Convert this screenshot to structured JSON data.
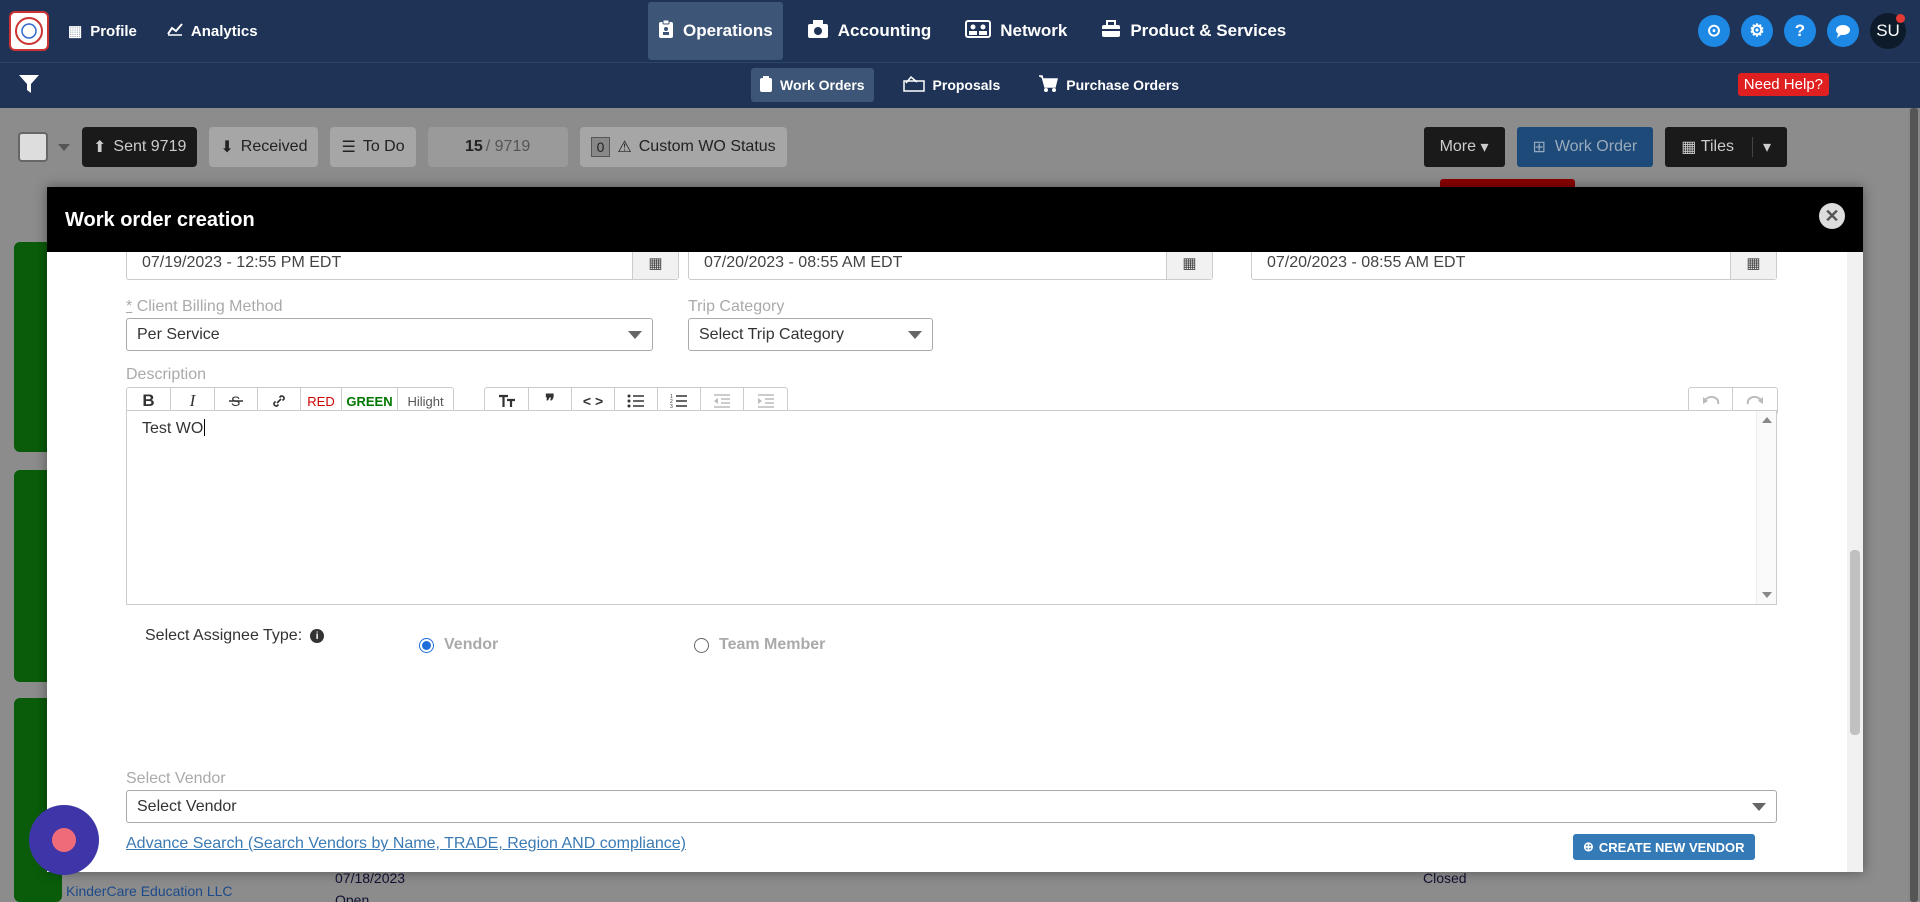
{
  "topnav": {
    "left": [
      {
        "label": "Profile",
        "icon": "building-icon"
      },
      {
        "label": "Analytics",
        "icon": "chart-line-icon"
      }
    ],
    "center": [
      {
        "label": "Operations",
        "icon": "clipboard-icon",
        "active": true
      },
      {
        "label": "Accounting",
        "icon": "money-icon"
      },
      {
        "label": "Network",
        "icon": "people-icon"
      },
      {
        "label": "Product & Services",
        "icon": "briefcase-icon"
      }
    ],
    "avatar": "SU"
  },
  "subnav": {
    "items": [
      {
        "label": "Work Orders",
        "icon": "clipboard-icon",
        "active": true
      },
      {
        "label": "Proposals",
        "icon": "proposal-icon"
      },
      {
        "label": "Purchase Orders",
        "icon": "cart-icon"
      }
    ],
    "need_help": "Need Help?"
  },
  "background_toolbar": {
    "sent": "Sent 9719",
    "received": "Received",
    "todo": "To Do",
    "count_current": "15",
    "count_total": "/ 9719",
    "custom_count": "0",
    "custom_status": "Custom WO Status",
    "more": "More",
    "work_order": "Work Order",
    "tiles": "Tiles"
  },
  "background_rows": {
    "client": "KinderCare Education LLC",
    "date": "07/18/2023",
    "status_open": "Open",
    "status_closed": "Closed"
  },
  "modal": {
    "title": "Work order creation",
    "dates": [
      "07/19/2023 - 12:55 PM EDT",
      "07/20/2023 - 08:55 AM EDT",
      "07/20/2023 - 08:55 AM EDT"
    ],
    "billing_required": "*",
    "billing_label": "Client Billing Method",
    "billing_value": "Per Service",
    "trip_label": "Trip Category",
    "trip_value": "Select Trip Category",
    "description_label": "Description",
    "toolbar": {
      "bold": "B",
      "italic": "I",
      "red": "RED",
      "green": "GREEN",
      "hilight": "Hilight"
    },
    "description_text": "Test WO",
    "assignee_label": "Select Assignee Type:",
    "assignee_options": [
      {
        "label": "Vendor",
        "selected": true
      },
      {
        "label": "Team Member",
        "selected": false
      }
    ],
    "vendor_label": "Select Vendor",
    "vendor_value": "Select Vendor",
    "advance_search": "Advance Search (Search Vendors by Name, TRADE, Region AND compliance)",
    "create_vendor": "CREATE NEW VENDOR"
  },
  "colors": {
    "nav_bg": "#1e3355",
    "accent_blue": "#1e88e5",
    "need_help_red": "#e02020"
  }
}
